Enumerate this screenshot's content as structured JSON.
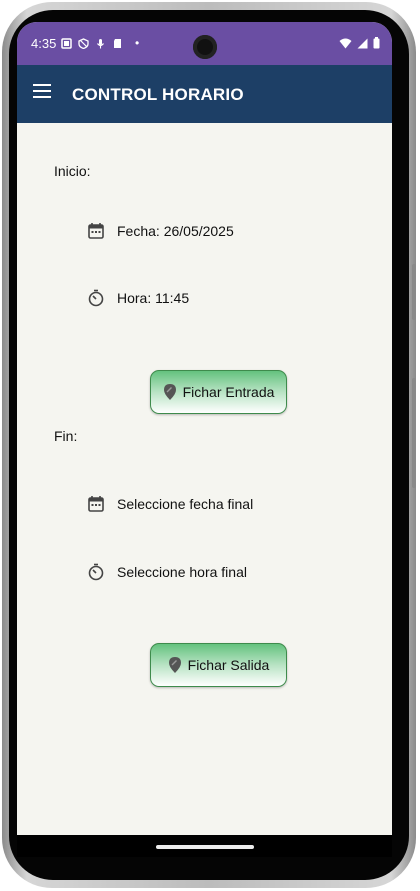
{
  "status_bar": {
    "time": "4:35",
    "dot": "•"
  },
  "app_bar": {
    "title": "CONTROL HORARIO"
  },
  "inicio": {
    "label": "Inicio:",
    "fecha": "Fecha: 26/05/2025",
    "hora": "Hora: 11:45",
    "button_label": "Fichar Entrada"
  },
  "fin": {
    "label": "Fin:",
    "fecha": "Seleccione fecha final",
    "hora": "Seleccione hora final",
    "button_label": "Fichar Salida"
  },
  "icons": {
    "menu": "hamburger-menu",
    "date": "calendar",
    "time": "timer",
    "button": "location-pin"
  },
  "colors": {
    "status_bar": "#6a4ea3",
    "app_bar": "#1d3f66",
    "background": "#f5f5f0",
    "button_top": "#64c27e",
    "button_border": "#3e8b4c"
  }
}
